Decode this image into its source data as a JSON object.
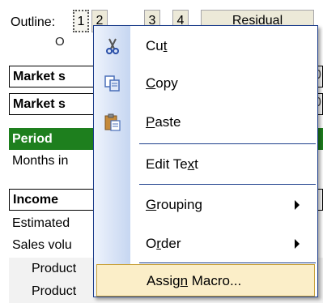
{
  "outline": {
    "label": "Outline:",
    "levels": [
      "1",
      "2",
      "3",
      "4"
    ],
    "residual_label": "Residual",
    "on_label": "O",
    "selected_level": "1"
  },
  "rows": [
    {
      "text": "Market s",
      "style": "boxed",
      "right": "0"
    },
    {
      "text": "Market s",
      "style": "boxed",
      "right": "0"
    },
    {
      "text": "Period",
      "style": "period",
      "right": ""
    },
    {
      "text": "Months in",
      "style": "plain",
      "right": ""
    },
    {
      "text": "Income",
      "style": "boxed",
      "right": ""
    },
    {
      "text": "Estimated",
      "style": "plain",
      "right": ""
    },
    {
      "text": "Sales volu",
      "style": "plain",
      "right": ""
    },
    {
      "text": "Product",
      "style": "shaded",
      "right": ""
    },
    {
      "text": "Product",
      "style": "shaded",
      "right": ""
    }
  ],
  "menu": {
    "items": [
      {
        "pre": "Cu",
        "acc": "t",
        "post": "",
        "icon": "scissors-icon",
        "submenu": false
      },
      {
        "pre": "",
        "acc": "C",
        "post": "opy",
        "icon": "copy-icon",
        "submenu": false
      },
      {
        "pre": "",
        "acc": "P",
        "post": "aste",
        "icon": "paste-icon",
        "submenu": false
      },
      {
        "pre": "Edit Te",
        "acc": "x",
        "post": "t",
        "icon": "",
        "submenu": false
      },
      {
        "pre": "",
        "acc": "G",
        "post": "rouping",
        "icon": "",
        "submenu": true
      },
      {
        "pre": "O",
        "acc": "r",
        "post": "der",
        "icon": "",
        "submenu": true
      },
      {
        "pre": "Assig",
        "acc": "n",
        "post": " Macro...",
        "icon": "",
        "submenu": false,
        "hovered": true
      }
    ]
  },
  "colors": {
    "period_fill": "#1e7f1e",
    "menu_border": "#1e3f8c",
    "menu_hover": "#fbeec8",
    "menu_hover_border": "#c9a23d"
  }
}
